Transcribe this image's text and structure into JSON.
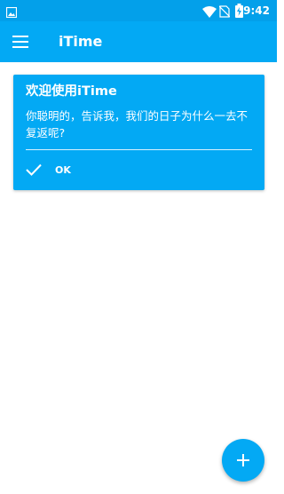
{
  "status_bar": {
    "time": "9:42",
    "icons": [
      "image-icon",
      "wifi-icon",
      "no-sim-icon",
      "battery-charging-icon"
    ]
  },
  "app_bar": {
    "title": "iTime",
    "menu_icon": "hamburger-menu-icon"
  },
  "card": {
    "title": "欢迎使用iTime",
    "message": "你聪明的，告诉我，我们的日子为什么一去不复返呢?",
    "action_label": "OK",
    "action_icon": "check-icon"
  },
  "fab": {
    "icon": "plus-icon"
  },
  "colors": {
    "primary": "#03a9f4",
    "status_bar": "#03a0ea",
    "background": "#ffffff",
    "on_primary": "#ffffff"
  }
}
